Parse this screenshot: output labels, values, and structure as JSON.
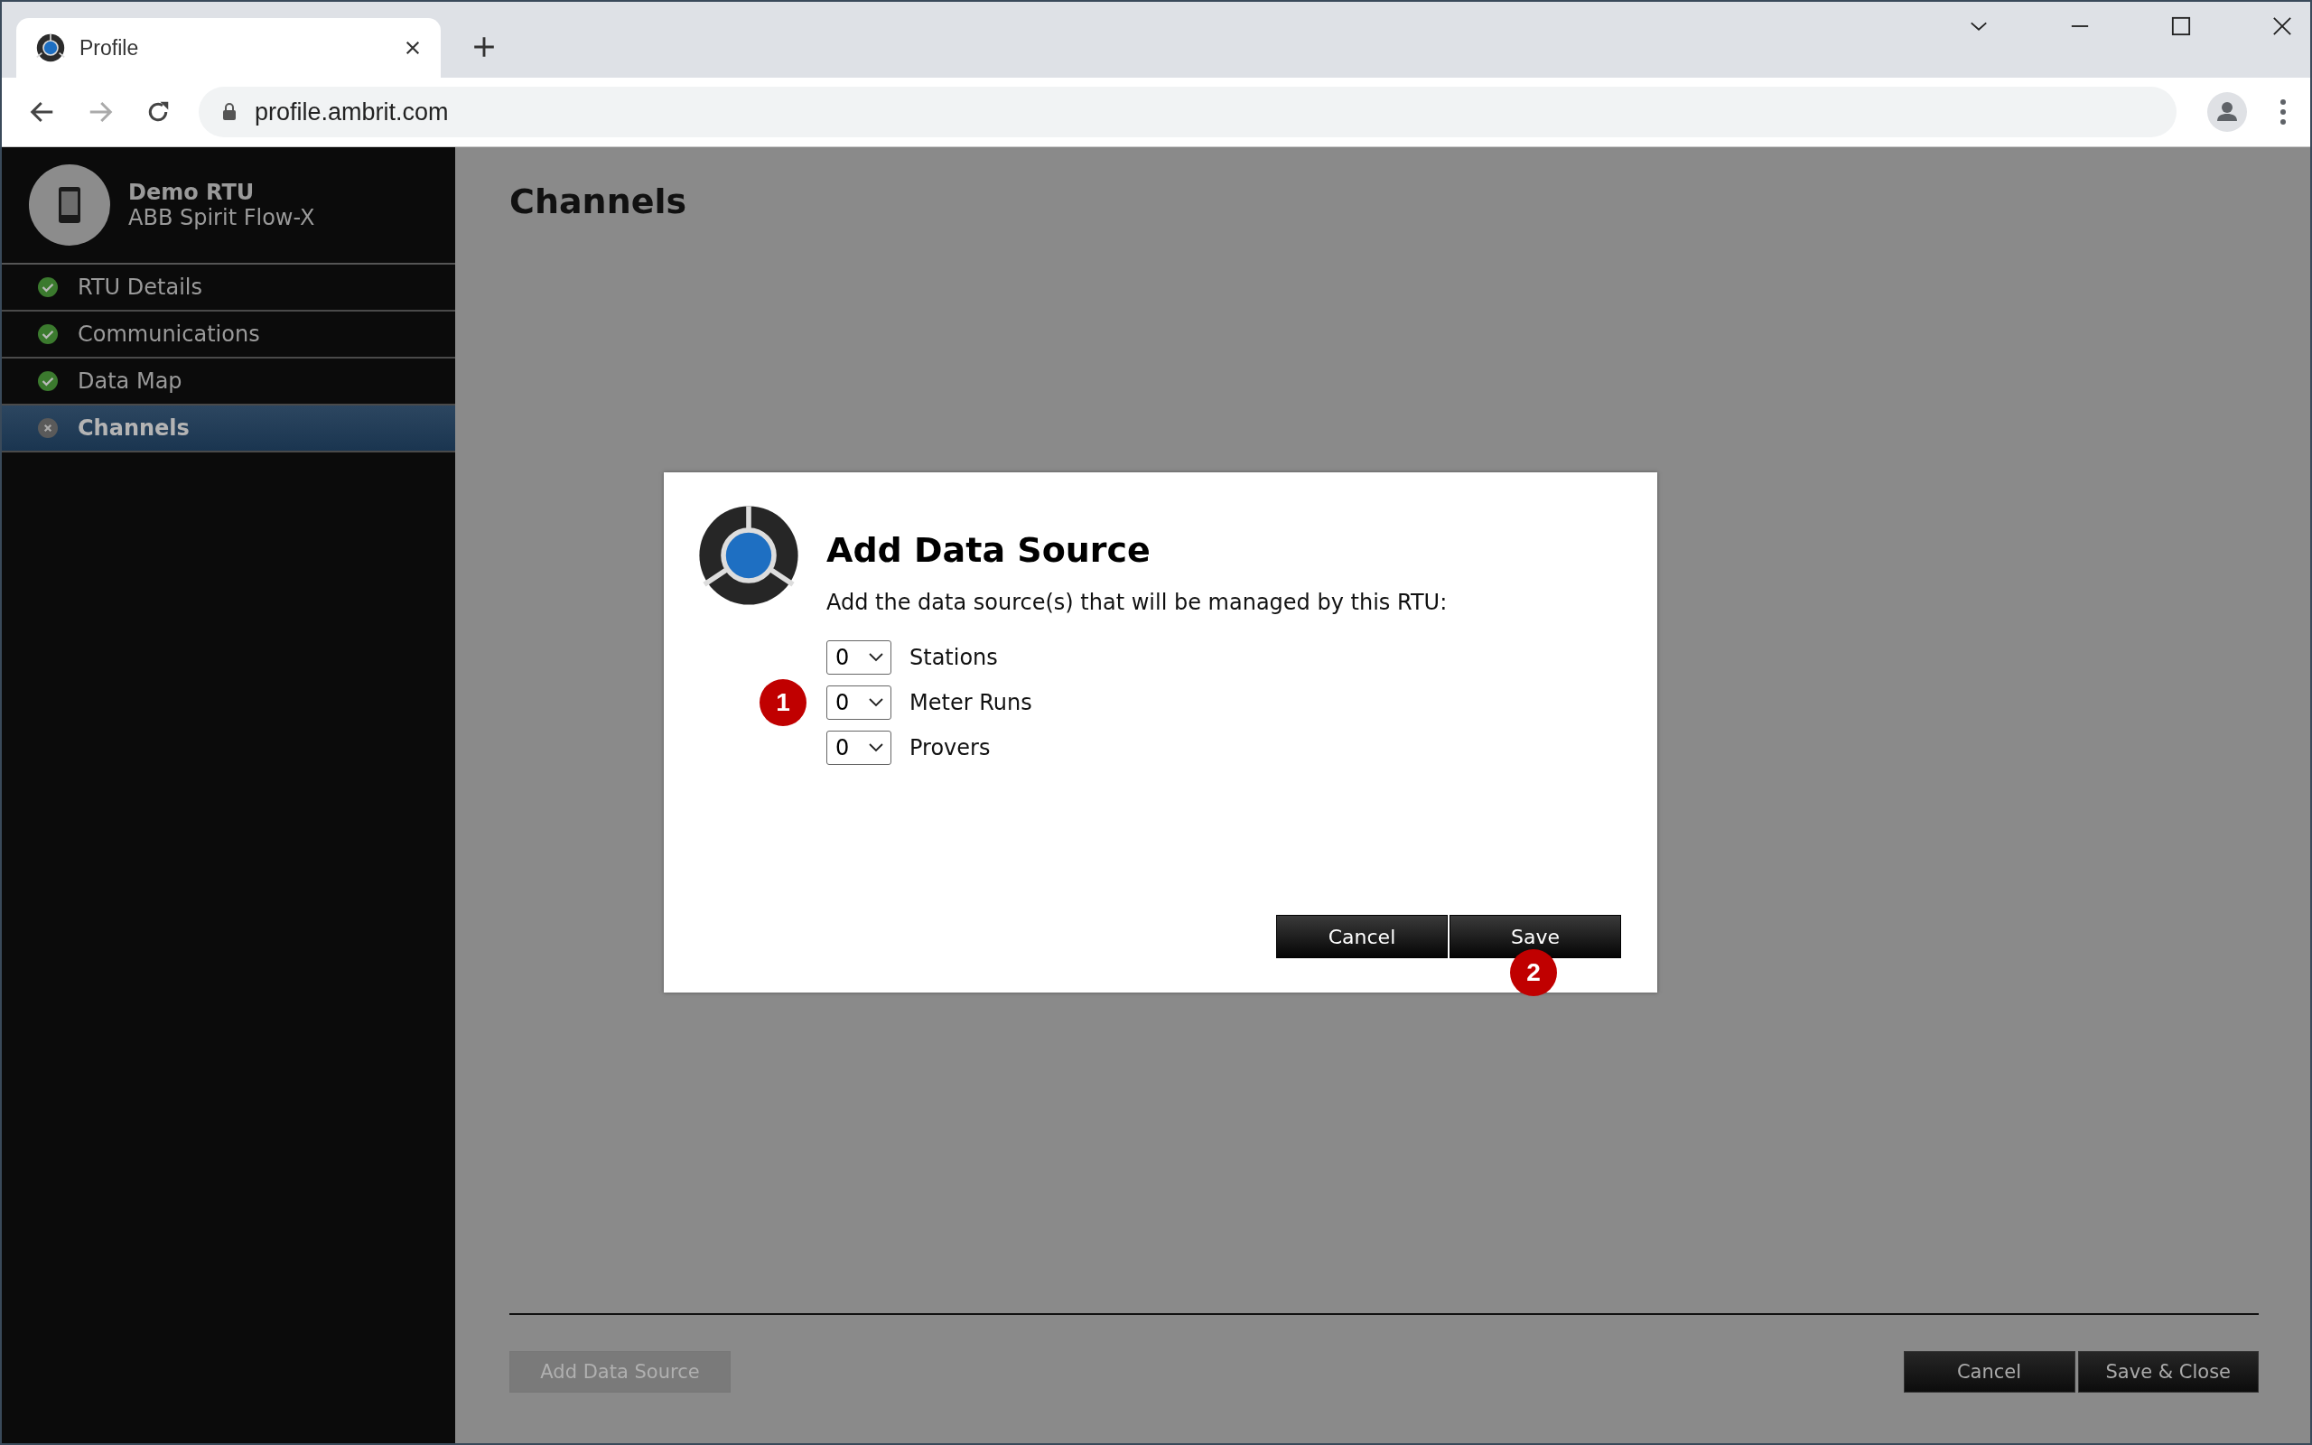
{
  "browser": {
    "tab": {
      "title": "Profile",
      "selected": true
    },
    "address": "profile.ambrit.com"
  },
  "sidebar": {
    "device_name": "Demo RTU",
    "device_model": "ABB Spirit Flow-X",
    "items": [
      {
        "label": "RTU Details",
        "complete": true,
        "selected": false
      },
      {
        "label": "Communications",
        "complete": true,
        "selected": false
      },
      {
        "label": "Data Map",
        "complete": true,
        "selected": false
      },
      {
        "label": "Channels",
        "complete": false,
        "selected": true
      }
    ]
  },
  "page": {
    "title": "Channels",
    "buttons": [
      {
        "label": "Add Data Source",
        "disabled": true
      },
      {
        "label": "Cancel",
        "disabled": false
      },
      {
        "label": "Save & Close",
        "disabled": false
      }
    ]
  },
  "dialog": {
    "title": "Add Data Source",
    "prompt": "Add the data source(s) that will be managed by this RTU:",
    "rows": [
      {
        "value": "0",
        "label": "Stations"
      },
      {
        "value": "0",
        "label": "Meter Runs",
        "marker": "1"
      },
      {
        "value": "0",
        "label": "Provers"
      }
    ],
    "buttons": [
      {
        "label": "Cancel"
      },
      {
        "label": "Save",
        "marker": "2"
      }
    ]
  }
}
